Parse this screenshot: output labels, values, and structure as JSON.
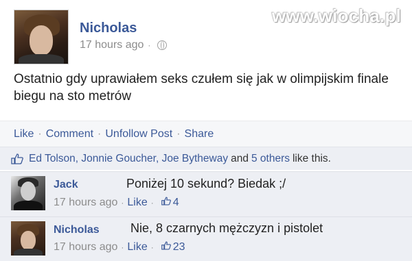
{
  "watermark": "www.wiocha.pl",
  "post": {
    "author": "Nicholas",
    "timestamp": "17 hours ago",
    "text": "Ostatnio gdy uprawiałem seks czułem się jak w olimpijskim finale biegu na sto metrów"
  },
  "actions": {
    "like": "Like",
    "comment": "Comment",
    "unfollow": "Unfollow Post",
    "share": "Share"
  },
  "likes": {
    "names": "Ed Tolson, Jonnie Goucher, Joe Bytheway",
    "and": "and",
    "others": "5 others",
    "suffix": "like this."
  },
  "comments": [
    {
      "author": "Jack",
      "text": "Poniżej 10 sekund? Biedak ;/",
      "timestamp": "17 hours ago",
      "like_label": "Like",
      "like_count": "4"
    },
    {
      "author": "Nicholas",
      "text": "Nie, 8 czarnych mężczyzn i pistolet",
      "timestamp": "17 hours ago",
      "like_label": "Like",
      "like_count": "23"
    }
  ],
  "colors": {
    "link": "#3b5998",
    "meta": "#8c8c8c",
    "panel": "#edeff4"
  }
}
